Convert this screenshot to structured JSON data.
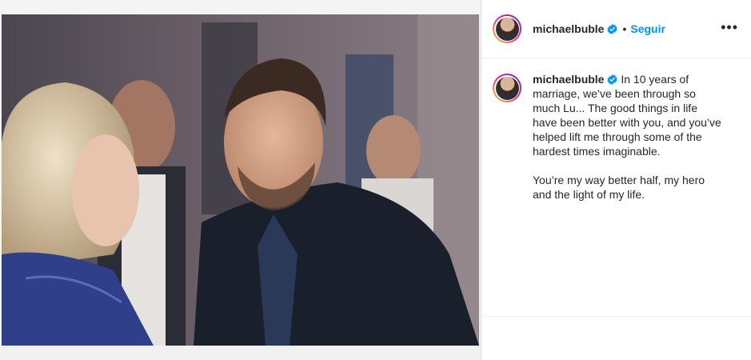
{
  "post": {
    "author": "michaelbuble",
    "separator": "•",
    "follow_label": "Seguir",
    "more_label": "•••",
    "caption": "In 10 years of marriage, we’ve been through so much Lu... The good things in life have been better with you, and you’ve helped lift me through some of the hardest times imaginable.\n\nYou’re my way better half, my hero and the light of my life."
  },
  "icons": {
    "verified": "verified-badge-icon",
    "more": "more-options-icon"
  },
  "colors": {
    "accent": "#0095f6",
    "text": "#262626",
    "border": "#dbdbdb"
  }
}
